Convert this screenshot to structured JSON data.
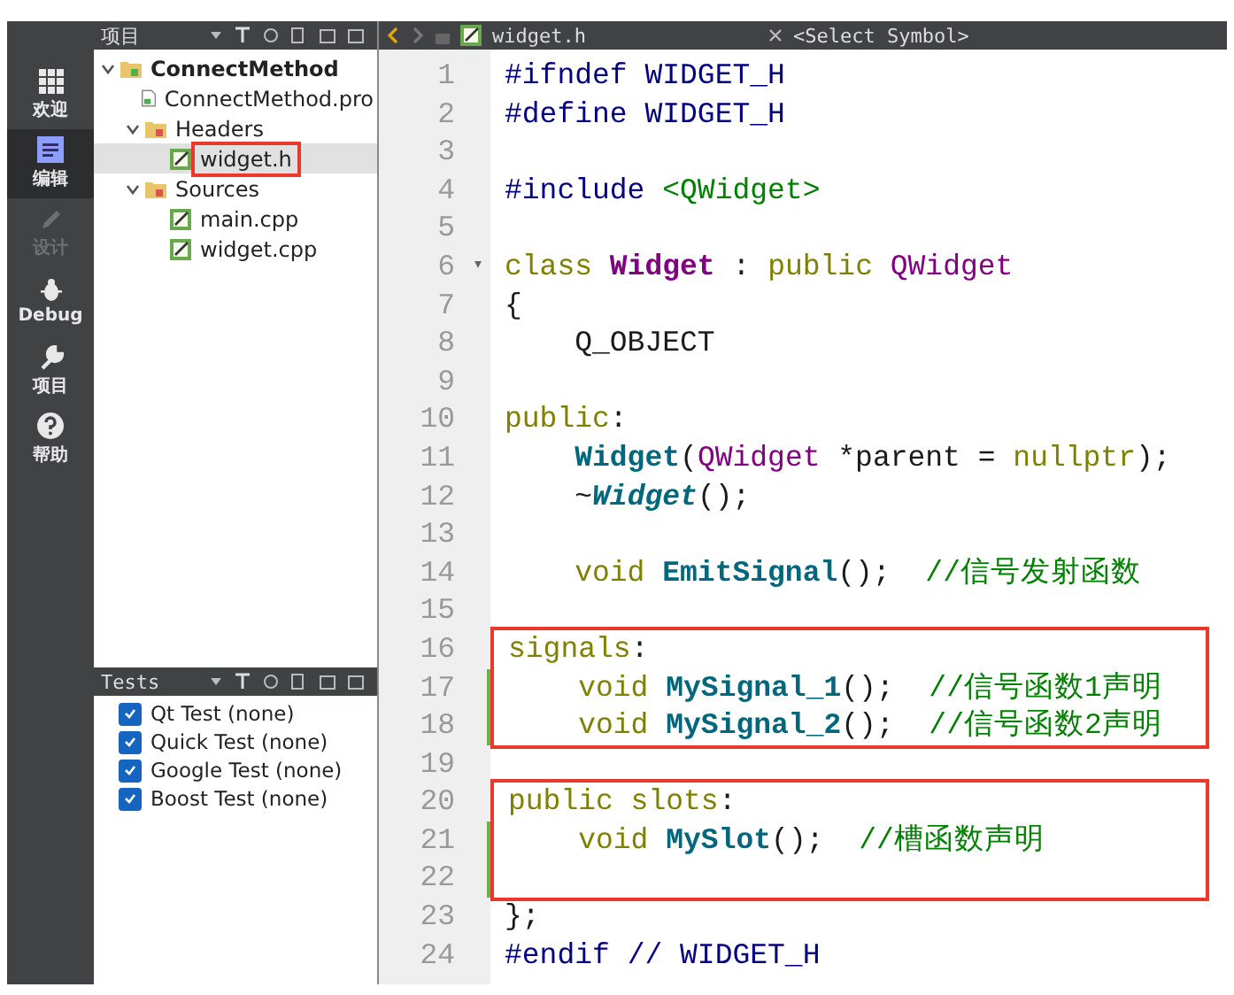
{
  "modes": [
    {
      "label": "欢迎",
      "kind": "welcome",
      "selected": false,
      "disabled": false
    },
    {
      "label": "编辑",
      "kind": "edit",
      "selected": true,
      "disabled": false
    },
    {
      "label": "设计",
      "kind": "design",
      "selected": false,
      "disabled": true
    },
    {
      "label": "Debug",
      "kind": "debug",
      "selected": false,
      "disabled": false
    },
    {
      "label": "项目",
      "kind": "projects",
      "selected": false,
      "disabled": false
    },
    {
      "label": "帮助",
      "kind": "help",
      "selected": false,
      "disabled": false
    }
  ],
  "project_panel": {
    "title": "项目",
    "tree": [
      {
        "label": "ConnectMethod",
        "kind": "project",
        "expanded": true,
        "selected": false,
        "highlighted": false,
        "children": [
          {
            "label": "ConnectMethod.pro",
            "kind": "pro",
            "selected": false,
            "highlighted": false
          },
          {
            "label": "Headers",
            "kind": "folder",
            "expanded": true,
            "selected": false,
            "highlighted": false,
            "children": [
              {
                "label": "widget.h",
                "kind": "file",
                "selected": true,
                "highlighted": true
              }
            ]
          },
          {
            "label": "Sources",
            "kind": "folder",
            "expanded": true,
            "selected": false,
            "highlighted": false,
            "children": [
              {
                "label": "main.cpp",
                "kind": "file",
                "selected": false,
                "highlighted": false
              },
              {
                "label": "widget.cpp",
                "kind": "file",
                "selected": false,
                "highlighted": false
              }
            ]
          }
        ]
      }
    ]
  },
  "tests_panel": {
    "title": "Tests",
    "items": [
      {
        "label": "Qt Test (none)",
        "checked": true
      },
      {
        "label": "Quick Test (none)",
        "checked": true
      },
      {
        "label": "Google Test (none)",
        "checked": true
      },
      {
        "label": "Boost Test (none)",
        "checked": true
      }
    ]
  },
  "editor": {
    "file": "widget.h",
    "symbol": "<Select Symbol>",
    "blocks": [
      {
        "boxed": false,
        "lines": [
          {
            "number": "1",
            "modified": false,
            "tokens": [
              {
                "kind": "pre",
                "text": "#ifndef WIDGET_H"
              }
            ]
          },
          {
            "number": "2",
            "modified": false,
            "tokens": [
              {
                "kind": "pre",
                "text": "#define WIDGET_H"
              }
            ]
          },
          {
            "number": "3",
            "modified": false
          },
          {
            "number": "4",
            "modified": false,
            "tokens": [
              {
                "kind": "pre",
                "text": "#include "
              },
              {
                "kind": "str",
                "text": "<QWidget>"
              }
            ]
          },
          {
            "number": "5",
            "modified": false
          },
          {
            "number": "6",
            "modified": false,
            "fold": "▾",
            "tokens": [
              {
                "kind": "kw",
                "text": "class "
              },
              {
                "kind": "type_bold",
                "text": "Widget"
              },
              {
                "kind": "plain",
                "text": " : "
              },
              {
                "kind": "kw",
                "text": "public "
              },
              {
                "kind": "type",
                "text": "QWidget"
              }
            ]
          },
          {
            "number": "7",
            "modified": false,
            "tokens": [
              {
                "kind": "plain",
                "text": "{"
              }
            ]
          },
          {
            "number": "8",
            "modified": false,
            "tokens": [
              {
                "kind": "plain",
                "text": "    Q_OBJECT"
              }
            ]
          },
          {
            "number": "9",
            "modified": false
          },
          {
            "number": "10",
            "modified": false,
            "tokens": [
              {
                "kind": "kw",
                "text": "public"
              },
              {
                "kind": "plain",
                "text": ":"
              }
            ]
          },
          {
            "number": "11",
            "modified": false,
            "tokens": [
              {
                "kind": "func",
                "text": "    Widget"
              },
              {
                "kind": "plain",
                "text": "("
              },
              {
                "kind": "type",
                "text": "QWidget"
              },
              {
                "kind": "plain",
                "text": " *parent = "
              },
              {
                "kind": "kw",
                "text": "nullptr"
              },
              {
                "kind": "plain",
                "text": ");"
              }
            ]
          },
          {
            "number": "12",
            "modified": false,
            "tokens": [
              {
                "kind": "plain",
                "text": "    ~"
              },
              {
                "kind": "func_italic",
                "text": "Widget"
              },
              {
                "kind": "plain",
                "text": "();"
              }
            ]
          },
          {
            "number": "13",
            "modified": false
          },
          {
            "number": "14",
            "modified": false,
            "tokens": [
              {
                "kind": "kw",
                "text": "    void "
              },
              {
                "kind": "func",
                "text": "EmitSignal"
              },
              {
                "kind": "plain",
                "text": "();  "
              },
              {
                "kind": "comment",
                "text": "//信号发射函数"
              }
            ]
          },
          {
            "number": "15",
            "modified": false
          }
        ]
      },
      {
        "boxed": true,
        "lines": [
          {
            "number": "16",
            "modified": false,
            "tokens": [
              {
                "kind": "kw",
                "text": "signals"
              },
              {
                "kind": "plain",
                "text": ":"
              }
            ]
          },
          {
            "number": "17",
            "modified": true,
            "tokens": [
              {
                "kind": "kw",
                "text": "    void "
              },
              {
                "kind": "func",
                "text": "MySignal_1"
              },
              {
                "kind": "plain",
                "text": "();  "
              },
              {
                "kind": "comment",
                "text": "//信号函数1声明"
              }
            ]
          },
          {
            "number": "18",
            "modified": true,
            "tokens": [
              {
                "kind": "kw",
                "text": "    void "
              },
              {
                "kind": "func",
                "text": "MySignal_2"
              },
              {
                "kind": "plain",
                "text": "();  "
              },
              {
                "kind": "comment",
                "text": "//信号函数2声明"
              }
            ]
          }
        ]
      },
      {
        "boxed": false,
        "lines": [
          {
            "number": "19",
            "modified": false
          }
        ]
      },
      {
        "boxed": true,
        "lines": [
          {
            "number": "20",
            "modified": false,
            "tokens": [
              {
                "kind": "kw",
                "text": "public slots"
              },
              {
                "kind": "plain",
                "text": ":"
              }
            ]
          },
          {
            "number": "21",
            "modified": true,
            "tokens": [
              {
                "kind": "kw",
                "text": "    void "
              },
              {
                "kind": "func",
                "text": "MySlot"
              },
              {
                "kind": "plain",
                "text": "();  "
              },
              {
                "kind": "comment",
                "text": "//槽函数声明"
              }
            ]
          },
          {
            "number": "22",
            "modified": true
          }
        ]
      },
      {
        "boxed": false,
        "lines": [
          {
            "number": "23",
            "modified": false,
            "tokens": [
              {
                "kind": "plain",
                "text": "};"
              }
            ]
          },
          {
            "number": "24",
            "modified": false,
            "tokens": [
              {
                "kind": "pre",
                "text": "#endif "
              },
              {
                "kind": "comment_pre",
                "text": "// WIDGET_H"
              }
            ]
          }
        ]
      }
    ]
  }
}
